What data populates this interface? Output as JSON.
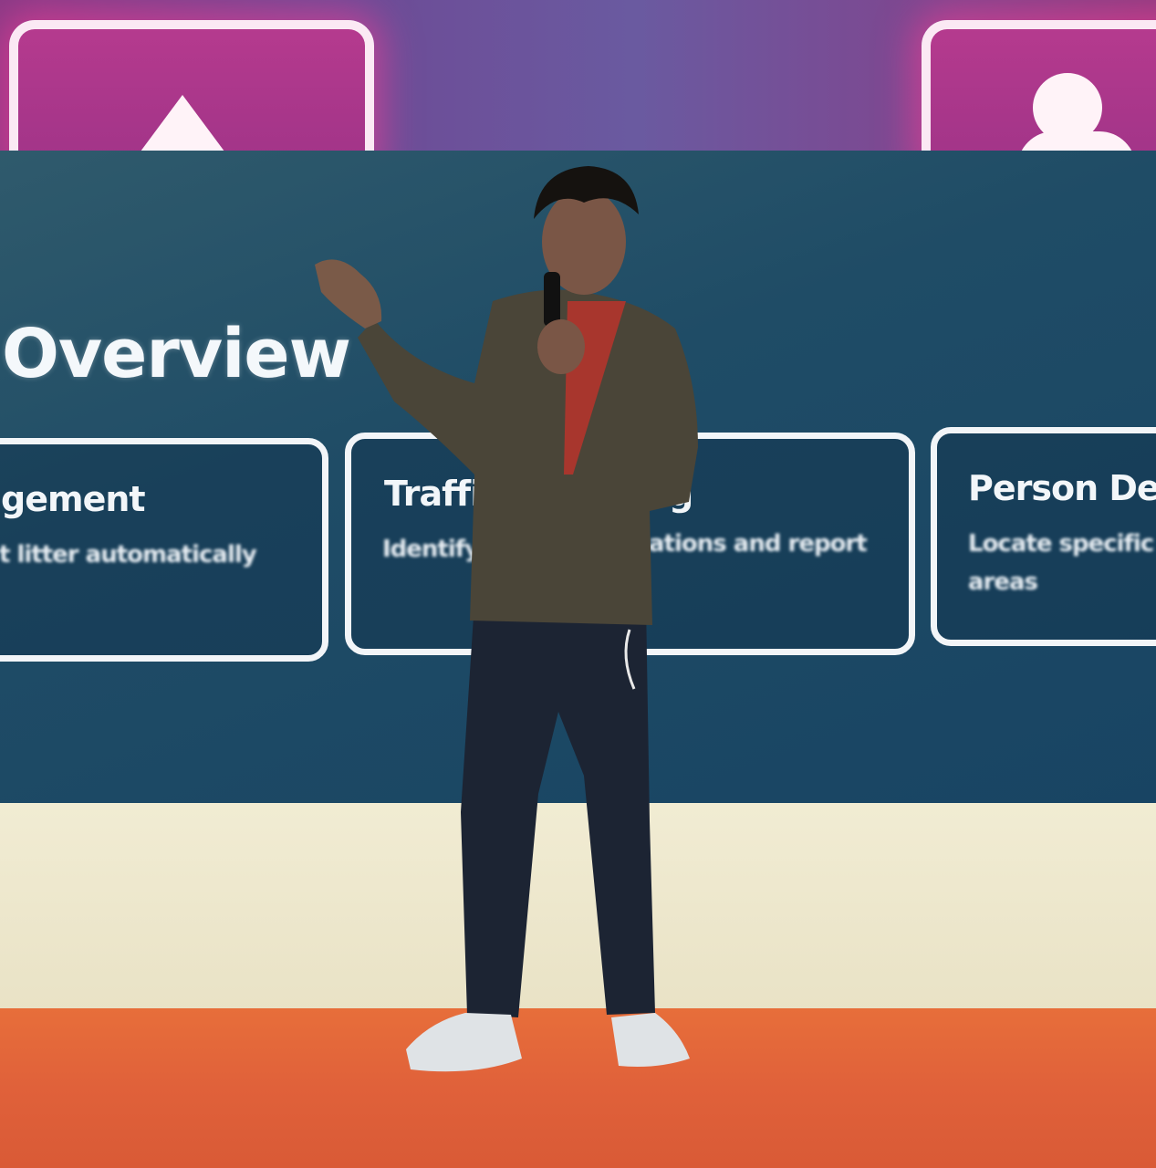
{
  "slide": {
    "title": "Overview",
    "cards": [
      {
        "title": "gement",
        "desc": "t litter automatically"
      },
      {
        "title": "Traffic",
        "title_tail": "g",
        "desc": "Identify",
        "desc_tail": "ations and report"
      },
      {
        "title": "Person Dete",
        "desc_line1": "Locate specific",
        "desc_line2": "areas"
      }
    ]
  },
  "icons": {
    "top_left": "triangle-icon",
    "top_right": "person-icon"
  },
  "colors": {
    "slide_bg": "#1f4c66",
    "top_band": "#6d4b96",
    "stage_floor": "#e0613a",
    "stage_wall": "#ece6cb"
  }
}
